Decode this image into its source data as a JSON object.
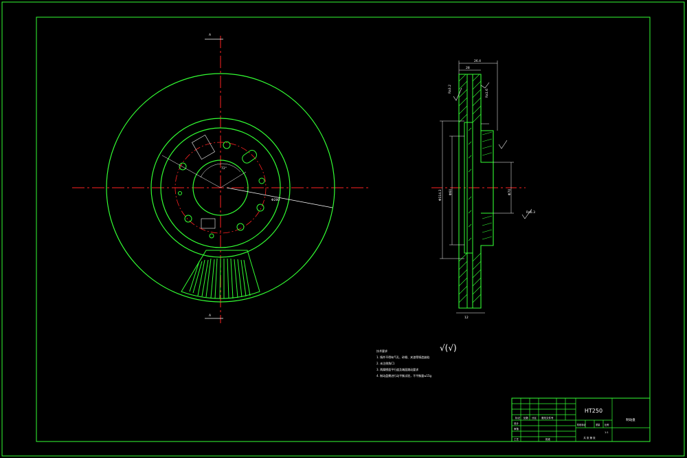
{
  "drawing": {
    "material": "HT250",
    "title_block": {
      "row1": [
        "标记",
        "处数",
        "分区",
        "更改文件号"
      ],
      "designer_label": "设计",
      "checker_label": "审核",
      "process_label": "工艺",
      "approve_label": "批准",
      "stage_label": "阶段标记",
      "weight_label": "重量",
      "scale_label": "比例",
      "scale_value": "1:1",
      "sheet_label": "共 张 第 张",
      "drawing_name": "制动盘"
    },
    "tech_notes": {
      "heading": "技术要求",
      "lines": [
        "1. 铸件不得有气孔、砂眼、夹渣等铸造缺陷",
        "2. 未注倒角C1",
        "3. 两摩擦面平行度及端面跳动要求",
        "4. 制动盘需进行动平衡试验，不平衡量≤15g"
      ]
    },
    "roughness_symbol": "√(√)",
    "section_marks": [
      "A",
      "A"
    ],
    "dimensions": {
      "overall_width": "26.4",
      "disc_thickness": "28",
      "hub_height": "12",
      "inner_dia": "Φ70",
      "bolt_circle": "Φ114.3",
      "center_bore": "Φ60",
      "outer_dia": "Φ280",
      "roughness_a": "Ra3.2",
      "roughness_b": "Ra1.6",
      "roughness_c": "Ra6.3",
      "angle": "72°"
    }
  }
}
